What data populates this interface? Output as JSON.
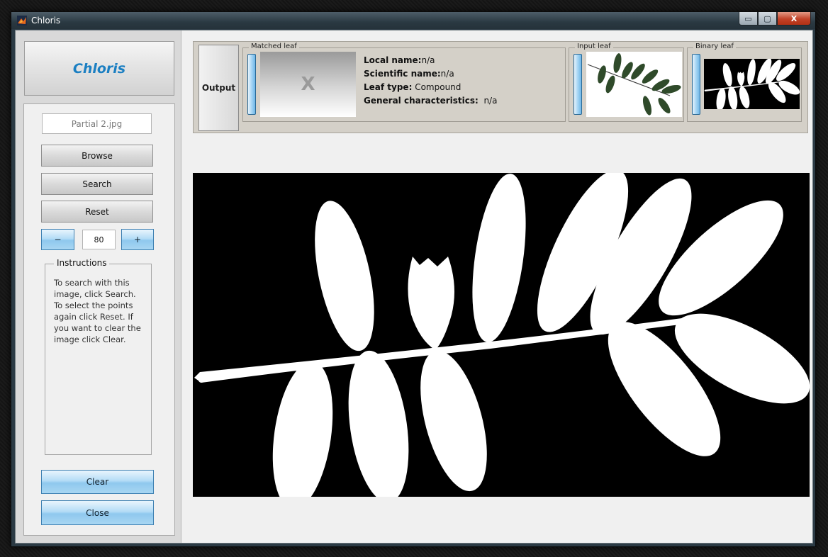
{
  "window": {
    "title": "Chloris",
    "controls": {
      "minimize": "▭",
      "maximize": "▢",
      "close": "X"
    }
  },
  "sidebar": {
    "logo": "Chloris",
    "file_name": "Partial 2.jpg",
    "browse_label": "Browse",
    "search_label": "Search",
    "reset_label": "Reset",
    "minus_label": "−",
    "plus_label": "+",
    "threshold_value": "80",
    "instructions_title": "Instructions",
    "instructions_text": "To search with this image, click Search. To select the points again click Reset. If you want to clear the image click Clear.",
    "clear_label": "Clear",
    "close_label": "Close"
  },
  "output": {
    "button_label": "Output",
    "matched_leaf_title": "Matched leaf",
    "matched_placeholder": "X",
    "local_name_label": "Local name:",
    "local_name_value": "n/a",
    "scientific_name_label": "Scientific name:",
    "scientific_name_value": "n/a",
    "leaf_type_label": "Leaf type:",
    "leaf_type_value": "Compound",
    "general_label": "General characteristics:",
    "general_value": "n/a",
    "input_leaf_title": "Input leaf",
    "binary_leaf_title": "Binary leaf"
  },
  "colors": {
    "accent_blue": "#1b7fc2",
    "leaf_green": "#2f4a2a"
  }
}
